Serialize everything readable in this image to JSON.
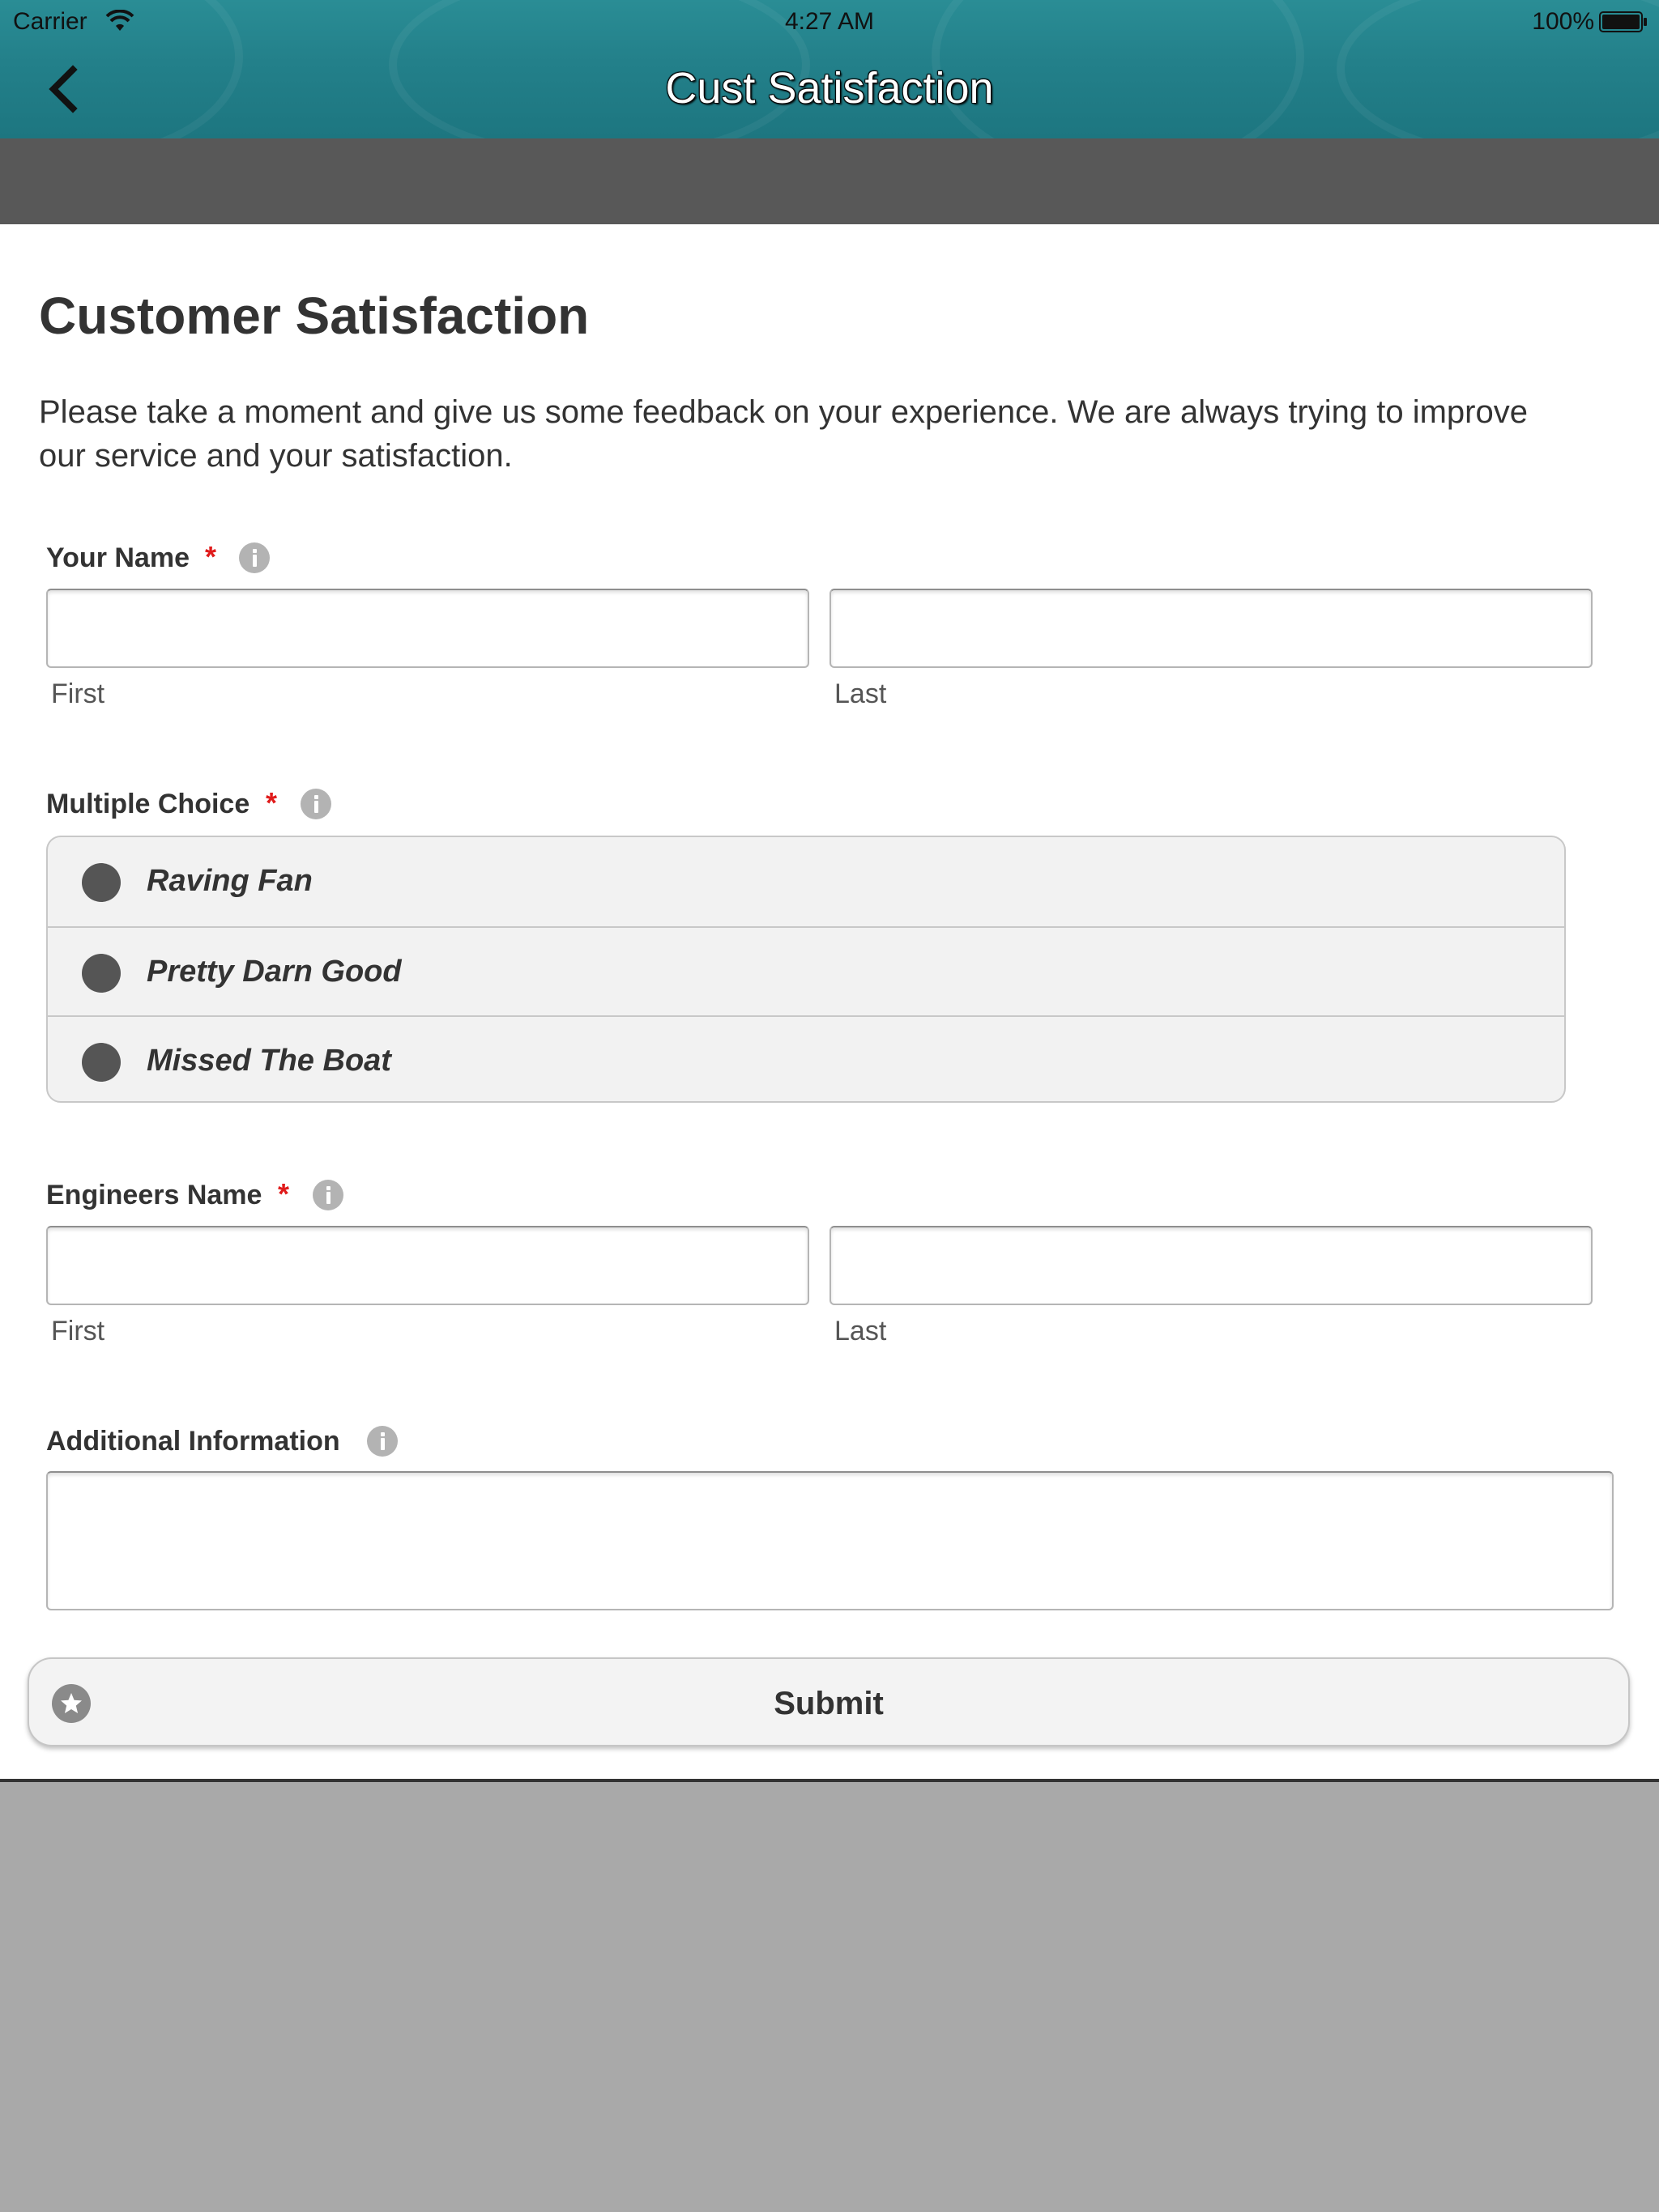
{
  "status_bar": {
    "carrier": "Carrier",
    "time": "4:27 AM",
    "battery": "100%"
  },
  "nav": {
    "title": "Cust Satisfaction",
    "back_icon": "chevron-left-icon"
  },
  "form": {
    "heading": "Customer Satisfaction",
    "intro": "Please take a moment and give us some feedback on your experience. We are always trying to improve our service and your satisfaction.",
    "required_marker": "*",
    "your_name": {
      "label": "Your Name",
      "first_value": "",
      "last_value": "",
      "first_sublabel": "First",
      "last_sublabel": "Last"
    },
    "multiple_choice": {
      "label": "Multiple Choice",
      "options": [
        "Raving Fan",
        "Pretty Darn Good",
        "Missed The Boat"
      ],
      "selected": null
    },
    "engineers_name": {
      "label": "Engineers Name",
      "first_value": "",
      "last_value": "",
      "first_sublabel": "First",
      "last_sublabel": "Last"
    },
    "additional_info": {
      "label": "Additional Information",
      "value": ""
    },
    "submit": {
      "label": "Submit",
      "icon": "star-icon"
    }
  },
  "colors": {
    "header_teal": "#23808a",
    "band_gray": "#585858",
    "background_gray": "#a9a9a9",
    "required_red": "#e01b1b"
  }
}
